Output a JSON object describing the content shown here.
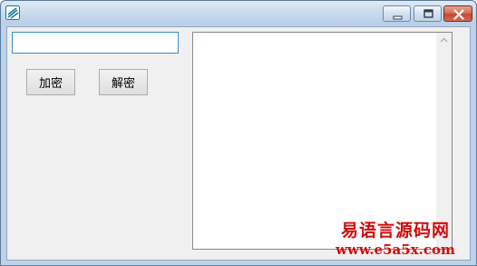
{
  "window": {
    "title": "",
    "minimize_icon": "minimize-icon",
    "maximize_icon": "maximize-icon",
    "close_icon": "close-icon",
    "app_icon": "app-icon"
  },
  "form": {
    "input_value": "",
    "encrypt_label": "加密",
    "decrypt_label": "解密",
    "output_text": ""
  },
  "watermark": {
    "line1": "易语言源码网",
    "line2": "www.e5a5x.com",
    "color": "#d10c0c"
  },
  "colors": {
    "titlebar": "#c7d9ec",
    "close_button": "#c44a33",
    "input_border": "#3a8ec4",
    "client_background": "#f0f0f0"
  }
}
